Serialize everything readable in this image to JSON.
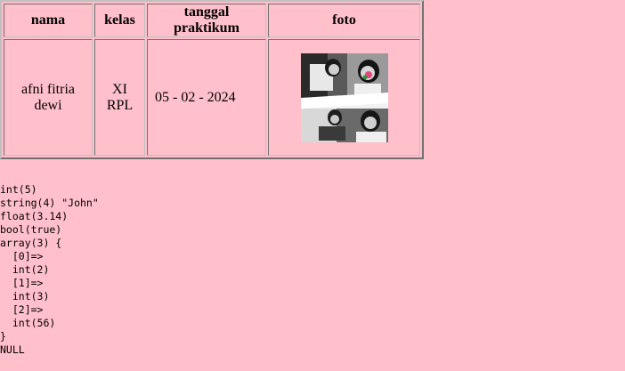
{
  "table": {
    "headers": [
      "nama",
      "kelas",
      "tanggal praktikum",
      "foto"
    ],
    "row": {
      "nama": "afni fitria dewi",
      "kelas": "XI RPL",
      "tanggal": "05 - 02 - 2024"
    }
  },
  "dump": {
    "lines": [
      "int(5)",
      "string(4) \"John\"",
      "float(3.14)",
      "bool(true)",
      "array(3) {",
      "  [0]=>",
      "  int(2)",
      "  [1]=>",
      "  int(3)",
      "  [2]=>",
      "  int(56)",
      "}",
      "NULL"
    ]
  },
  "colors": {
    "background": "#ffc0cb",
    "flower_accent": "#e0487a",
    "leaf_accent": "#3a8a3a"
  },
  "icons": {
    "photo": "photo-collage-image"
  }
}
